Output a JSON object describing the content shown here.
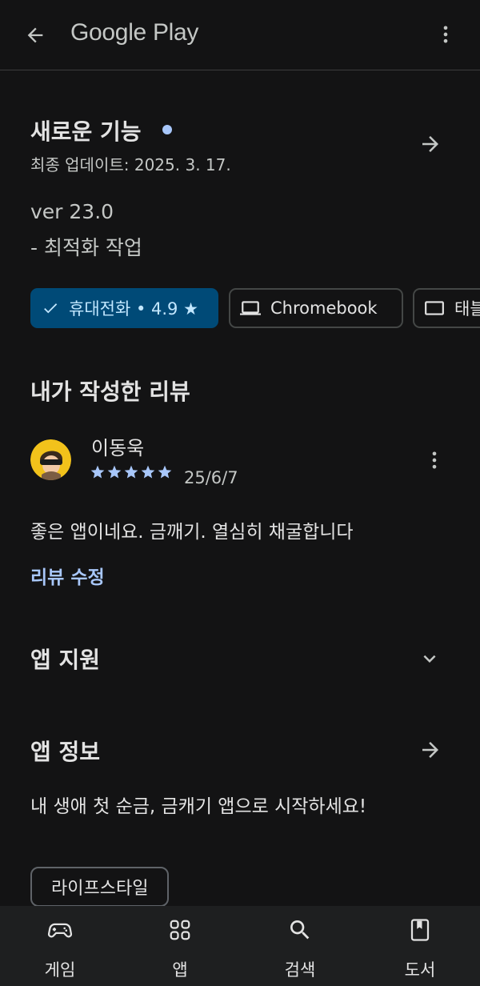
{
  "appbar": {
    "title": "Google Play",
    "back_icon": "arrow-back-icon",
    "more_icon": "more-vert-icon"
  },
  "whats_new": {
    "title": "새로운 기능",
    "updated": "최종 업데이트: 2025. 3. 17.",
    "version": "ver 23.0",
    "note": "- 최적화 작업"
  },
  "devices": [
    {
      "label": "휴대전화 • 4.9 ★",
      "icon": "check-icon",
      "selected": true
    },
    {
      "label": "Chromebook",
      "icon": "laptop-icon",
      "selected": false
    },
    {
      "label": "태블",
      "icon": "tablet-icon",
      "selected": false
    }
  ],
  "my_review": {
    "section_title": "내가 작성한 리뷰",
    "author": "이동욱",
    "rating": 5,
    "date": "25/6/7",
    "text": "좋은 앱이네요. 금깨기. 열심히 채굴합니다",
    "edit_label": "리뷰 수정"
  },
  "app_support": {
    "title": "앱 지원"
  },
  "app_info": {
    "title": "앱 정보",
    "description": "내 생애 첫 순금, 금캐기 앱으로 시작하세요!",
    "tag": "라이프스타일"
  },
  "bottom_nav": [
    {
      "label": "게임",
      "icon": "gamepad-icon"
    },
    {
      "label": "앱",
      "icon": "apps-grid-icon"
    },
    {
      "label": "검색",
      "icon": "search-icon"
    },
    {
      "label": "도서",
      "icon": "book-icon"
    }
  ],
  "colors": {
    "background": "#131314",
    "accent": "#a8c7fa",
    "chip_selected_bg": "#004a77",
    "chip_selected_text": "#c2e7ff",
    "nav_bg": "#1e1f20"
  }
}
